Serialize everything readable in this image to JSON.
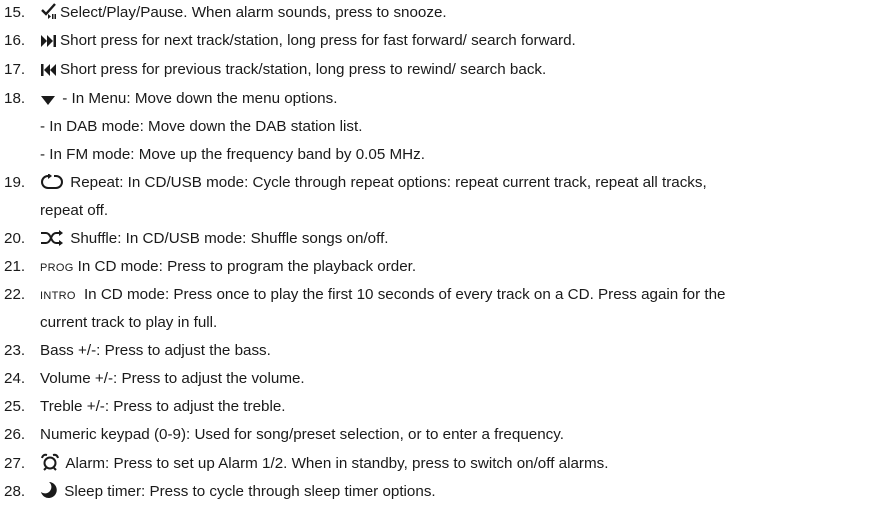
{
  "items": [
    {
      "num": "15.",
      "icon": "select-play-pause-icon",
      "text": "Select/Play/Pause. When alarm sounds, press to snooze."
    },
    {
      "num": "16.",
      "icon": "next-track-icon",
      "text": "Short press for next track/station, long press for fast forward/ search forward."
    },
    {
      "num": "17.",
      "icon": "previous-track-icon",
      "text": "Short press for previous track/station, long press to rewind/ search back."
    },
    {
      "num": "18.",
      "icon": "down-arrow-icon",
      "text": " - In Menu: Move down the menu options.",
      "sub": [
        "- In DAB mode: Move down the DAB station list.",
        "- In FM mode: Move up the frequency band by 0.05 MHz."
      ]
    },
    {
      "num": "19.",
      "icon": "repeat-icon",
      "text": " Repeat: In CD/USB mode: Cycle through repeat options: repeat current track, repeat all tracks,",
      "cont": "repeat off."
    },
    {
      "num": "20.",
      "icon": "shuffle-icon",
      "text": " Shuffle: In CD/USB mode: Shuffle songs on/off."
    },
    {
      "num": "21.",
      "label": "PROG",
      "text": "In CD mode: Press to program the playback order."
    },
    {
      "num": "22.",
      "label": "INTRO",
      "text": " In CD mode: Press once to play the first 10 seconds of every track on a CD. Press again for the",
      "cont": "current track to play in full."
    },
    {
      "num": "23.",
      "text": "Bass +/-: Press to adjust the bass."
    },
    {
      "num": "24.",
      "text": "Volume +/-: Press to adjust the volume."
    },
    {
      "num": "25.",
      "text": "Treble +/-: Press to adjust the treble."
    },
    {
      "num": "26.",
      "text": "Numeric keypad (0-9): Used for song/preset selection, or to enter a frequency."
    },
    {
      "num": "27.",
      "icon": "alarm-clock-icon",
      "text": " Alarm: Press to set up Alarm 1/2. When in standby, press to switch on/off alarms."
    },
    {
      "num": "28.",
      "icon": "sleep-moon-icon",
      "text": " Sleep timer: Press to cycle through sleep timer options."
    }
  ]
}
